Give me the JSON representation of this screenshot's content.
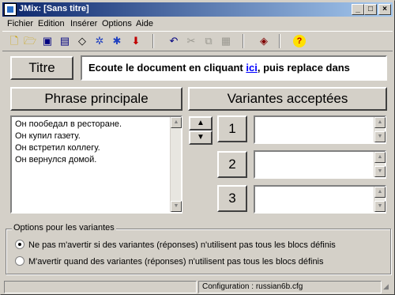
{
  "window": {
    "title": "JMix: [Sans titre]"
  },
  "titlebar_buttons": {
    "minimize": "_",
    "maximize": "□",
    "close": "×"
  },
  "menu": [
    "Fichier",
    "Edition",
    "Insérer",
    "Options",
    "Aide"
  ],
  "toolbar": {
    "icons": [
      "new-icon",
      "open-icon",
      "save-icon",
      "save-as-icon",
      "clear-icon",
      "web-icon",
      "web-alt-icon",
      "export-icon",
      "undo-icon",
      "cut-icon",
      "copy-icon",
      "paste-icon",
      "config-icon",
      "help-icon"
    ]
  },
  "titre": {
    "label": "Titre",
    "value_before": "Ecoute le document en cliquant ",
    "value_link": "ici",
    "value_after": ", puis replace dans"
  },
  "phrase": {
    "label": "Phrase principale",
    "lines": [
      "Он пообедал в ресторане.",
      "Он купил газету.",
      "Он встретил коллегу.",
      "Он вернулся домой."
    ]
  },
  "variantes": {
    "label": "Variantes acceptées",
    "numbers": [
      "1",
      "2",
      "3"
    ]
  },
  "options": {
    "legend": "Options pour les variantes",
    "radio1": "Ne pas m'avertir si des variantes (réponses) n'utilisent pas tous les blocs définis",
    "radio2": "M'avertir quand des variantes (réponses) n'utilisent pas tous les blocs définis",
    "selected": 1
  },
  "status": {
    "config": "Configuration : russian6b.cfg"
  }
}
